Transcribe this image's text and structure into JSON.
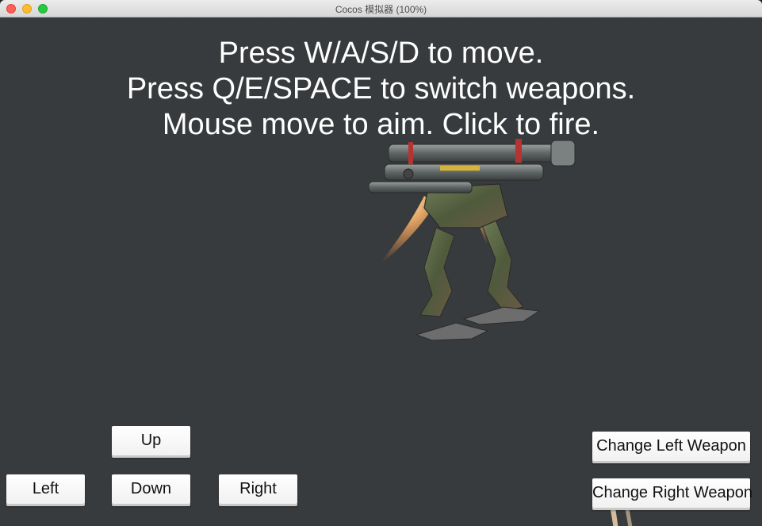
{
  "window": {
    "title": "Cocos 模拟器 (100%)"
  },
  "instructions": {
    "line1": "Press W/A/S/D to move.",
    "line2": "Press Q/E/SPACE to switch weapons.",
    "line3": "Mouse move to aim. Click to fire."
  },
  "controls": {
    "up": "Up",
    "down": "Down",
    "left": "Left",
    "right": "Right",
    "change_left_weapon": "Change Left Weapon",
    "change_right_weapon": "Change Right Weapon"
  },
  "colors": {
    "background": "#383b3d",
    "text": "#ffffff",
    "button": "#ffffff"
  }
}
